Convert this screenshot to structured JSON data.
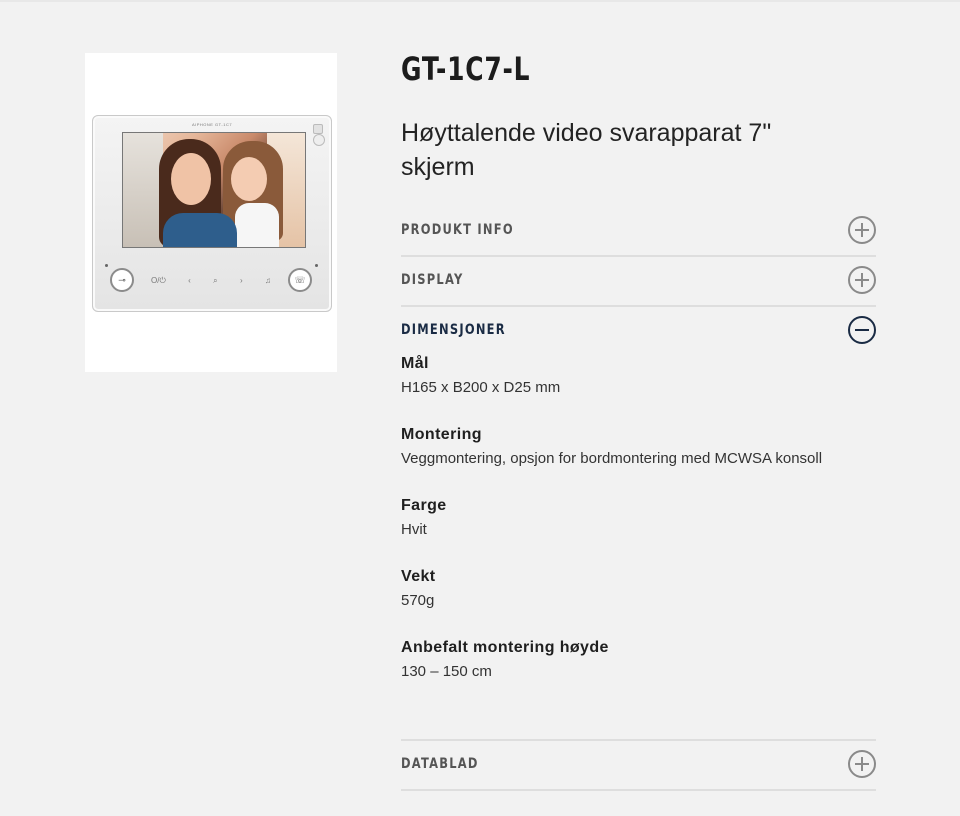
{
  "product": {
    "title": "GT-1C7-L",
    "subtitle": "Høyttalende video svarapparat 7\" skjerm"
  },
  "device_image": {
    "brand": "AIPHONE GT-1C7",
    "icons": [
      "O/⏻",
      "‹",
      "⌕",
      "›",
      "♫"
    ]
  },
  "accordion": [
    {
      "label": "PRODUKT INFO",
      "state": "collapsed",
      "icon": "plus-circle-icon"
    },
    {
      "label": "DISPLAY",
      "state": "collapsed",
      "icon": "plus-circle-icon"
    },
    {
      "label": "DIMENSJONER",
      "state": "expanded",
      "icon": "minus-circle-icon"
    },
    {
      "label": "DATABLAD",
      "state": "collapsed",
      "icon": "plus-circle-icon"
    }
  ],
  "specs": [
    {
      "label": "Mål",
      "value": "H165 x B200 x D25 mm"
    },
    {
      "label": "Montering",
      "value": "Veggmontering, opsjon for bordmontering med MCWSA konsoll"
    },
    {
      "label": "Farge",
      "value": "Hvit"
    },
    {
      "label": "Vekt",
      "value": "570g"
    },
    {
      "label": "Anbefalt montering høyde",
      "value": "130 – 150 cm"
    }
  ],
  "colors": {
    "background": "#f2f2f2",
    "active_heading": "#1a2b44",
    "inactive_heading": "#555555",
    "divider": "#dedede"
  }
}
